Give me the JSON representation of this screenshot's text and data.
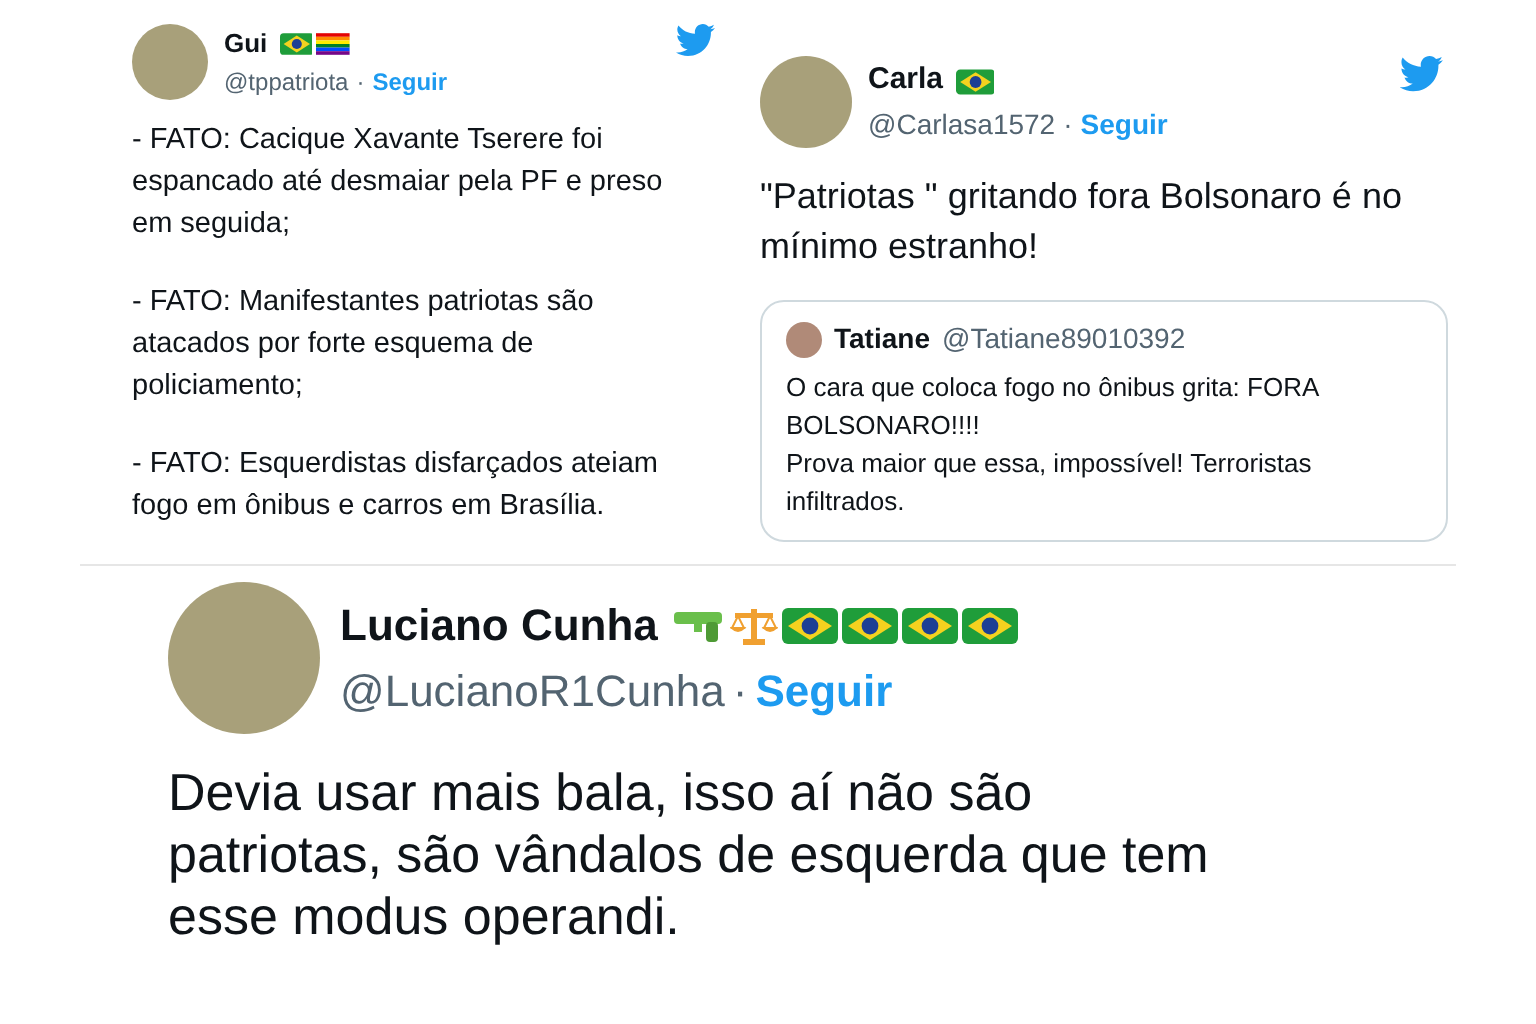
{
  "tweets": [
    {
      "name": "Gui",
      "badges": [
        {
          "kind": "brazil_flag"
        },
        {
          "kind": "rainbow_flag"
        }
      ],
      "handle": "@tppatriota",
      "separator": "·",
      "follow": "Seguir",
      "paragraphs": [
        "- FATO: Cacique Xavante Tserere foi espancado até desmaiar pela PF e preso em seguida;",
        "- FATO: Manifestantes patriotas são atacados por forte esquema de policiamento;",
        "- FATO: Esquerdistas disfarçados ateiam fogo em ônibus e carros em Brasília."
      ]
    },
    {
      "name": "Carla",
      "badges": [
        {
          "kind": "brazil_flag"
        }
      ],
      "handle": "@Carlasa1572",
      "separator": "·",
      "follow": "Seguir",
      "paragraphs": [
        "\"Patriotas \" gritando fora Bolsonaro é no mínimo estranho!"
      ],
      "quote": {
        "name": "Tatiane",
        "handle": "@Tatiane89010392",
        "lines": [
          "O cara que coloca fogo no ônibus grita: FORA BOLSONARO!!!!",
          "Prova maior que essa, impossível! Terroristas infiltrados."
        ]
      }
    },
    {
      "name": "Luciano Cunha",
      "badges": [
        {
          "kind": "water_gun"
        },
        {
          "kind": "scales"
        },
        {
          "kind": "brazil_flag"
        },
        {
          "kind": "brazil_flag"
        },
        {
          "kind": "brazil_flag"
        },
        {
          "kind": "brazil_flag"
        }
      ],
      "handle": "@LucianoR1Cunha",
      "separator": "·",
      "follow": "Seguir",
      "paragraphs": [
        "Devia usar mais bala, isso aí não são patriotas, são vândalos de esquerda que tem esse modus operandi."
      ]
    }
  ]
}
